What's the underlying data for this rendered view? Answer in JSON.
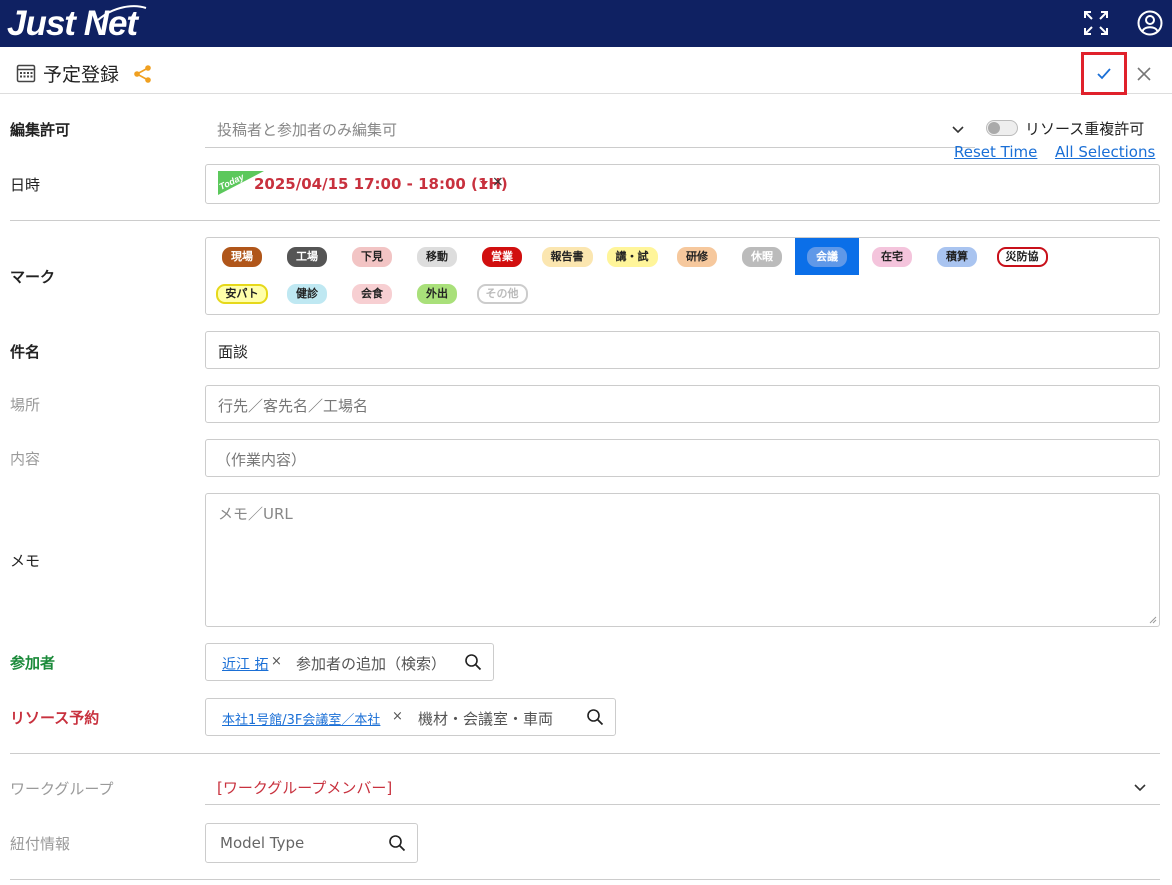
{
  "app": {
    "logo": "Just Net"
  },
  "header": {
    "title": "予定登録"
  },
  "form": {
    "edit_permission": {
      "label": "編集許可",
      "value": "投稿者と参加者のみ編集可"
    },
    "resource_dup": {
      "label": "リソース重複許可"
    },
    "links": {
      "reset_time": "Reset Time",
      "all_selections": "All Selections"
    },
    "datetime": {
      "label": "日時",
      "today_badge": "Today",
      "value": "2025/04/15 17:00 - 18:00 (1H)",
      "clear": "×"
    },
    "mark": {
      "label": "マーク",
      "selected": "会議",
      "items": [
        {
          "text": "現場",
          "bg": "#b0561a",
          "fg": "#ffffff",
          "border": ""
        },
        {
          "text": "工場",
          "bg": "#555555",
          "fg": "#ffffff",
          "border": ""
        },
        {
          "text": "下見",
          "bg": "#f2c4c4",
          "fg": "#222222",
          "border": ""
        },
        {
          "text": "移動",
          "bg": "#dddddd",
          "fg": "#222222",
          "border": ""
        },
        {
          "text": "営業",
          "bg": "#d10f0f",
          "fg": "#ffffff",
          "border": ""
        },
        {
          "text": "報告書",
          "bg": "#fbe6b0",
          "fg": "#222222",
          "border": ""
        },
        {
          "text": "講・試",
          "bg": "#fff59a",
          "fg": "#222222",
          "border": ""
        },
        {
          "text": "研修",
          "bg": "#f6c89d",
          "fg": "#222222",
          "border": ""
        },
        {
          "text": "休暇",
          "bg": "#bbbbbb",
          "fg": "#ffffff",
          "border": ""
        },
        {
          "text": "会議",
          "bg": "#5f98e8",
          "fg": "#ffffff",
          "border": ""
        },
        {
          "text": "在宅",
          "bg": "#f4c4dc",
          "fg": "#222222",
          "border": ""
        },
        {
          "text": "積算",
          "bg": "#a9c4f0",
          "fg": "#222222",
          "border": ""
        },
        {
          "text": "災防協",
          "bg": "#ffffff",
          "fg": "#222222",
          "border": "#c8101a"
        },
        {
          "text": "安パト",
          "bg": "#ffffaa",
          "fg": "#222222",
          "border": "#e6d81a"
        },
        {
          "text": "健診",
          "bg": "#bfe8f2",
          "fg": "#222222",
          "border": ""
        },
        {
          "text": "会食",
          "bg": "#f7cfd2",
          "fg": "#222222",
          "border": ""
        },
        {
          "text": "外出",
          "bg": "#a9e07a",
          "fg": "#222222",
          "border": ""
        },
        {
          "text": "その他",
          "bg": "#ffffff",
          "fg": "#bbbbbb",
          "border": "#cccccc"
        }
      ]
    },
    "subject": {
      "label": "件名",
      "value": "面談"
    },
    "place": {
      "label": "場所",
      "placeholder": "行先／客先名／工場名"
    },
    "content": {
      "label": "内容",
      "placeholder": "（作業内容）"
    },
    "memo": {
      "label": "メモ",
      "placeholder": "メモ／URL"
    },
    "participants": {
      "label": "参加者",
      "chip": "近江 拓",
      "remove": "×",
      "search_placeholder": "参加者の追加（検索）"
    },
    "resource": {
      "label": "リソース予約",
      "chip": "本社1号館/3F会議室／本社",
      "remove": "×",
      "search_placeholder": "機材・会議室・車両"
    },
    "workgroup": {
      "label": "ワークグループ",
      "value": "[ワークグループメンバー]"
    },
    "link_info": {
      "label": "紐付情報",
      "placeholder": "Model Type"
    }
  },
  "colors": {
    "topbar": "#0f2162",
    "accent": "#0b6fe8",
    "danger": "#c8313e",
    "green": "#1b8a3a"
  }
}
